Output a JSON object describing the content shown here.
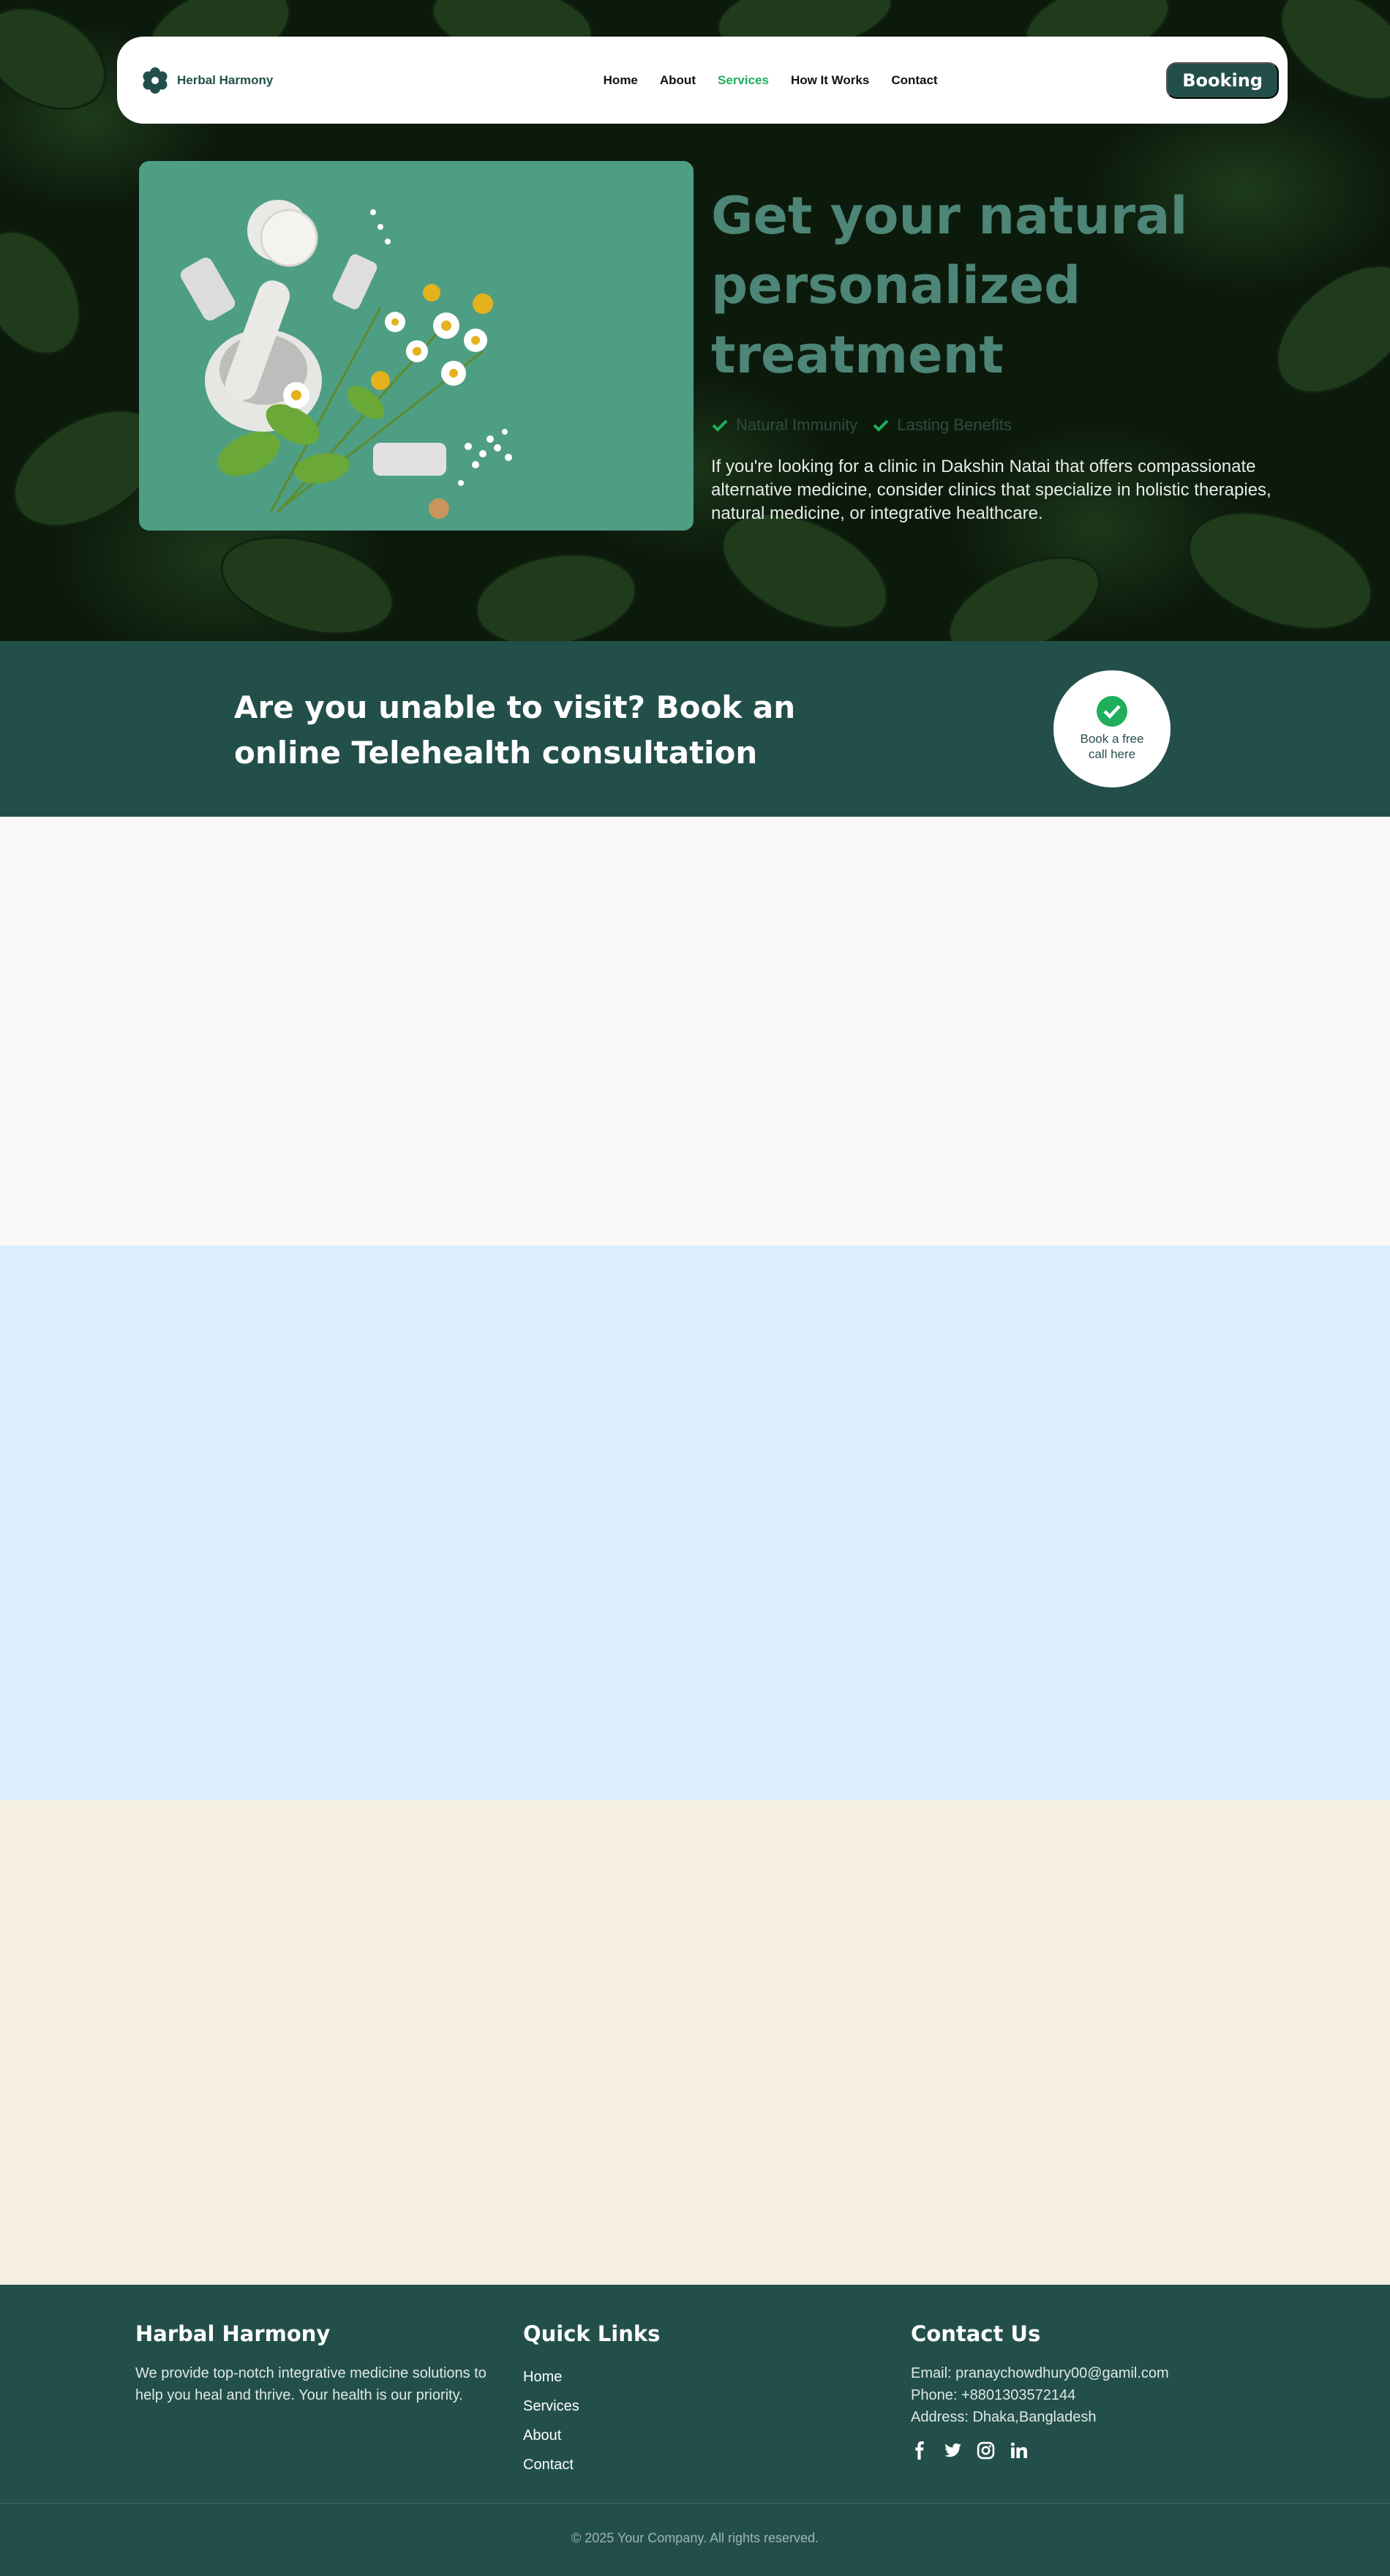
{
  "nav": {
    "brand": "Herbal Harmony",
    "links": [
      "Home",
      "About",
      "Services",
      "How It Works",
      "Contact"
    ],
    "active": "Services",
    "booking": "Booking"
  },
  "hero": {
    "title": "Get your natural personalized treatment",
    "badges": [
      "Natural Immunity",
      "Lasting Benefits"
    ],
    "description": "If you're looking for a clinic in Dakshin Natai that offers compassionate alternative medicine, consider clinics that specialize in holistic therapies, natural medicine, or integrative healthcare."
  },
  "telehealth": {
    "title": "Are you unable to visit? Book an online Telehealth consultation",
    "cta": "Book a free call here"
  },
  "footer": {
    "about": {
      "heading": "Harbal Harmony",
      "text": "We provide top-notch integrative medicine solutions to help you heal and thrive. Your health is our priority."
    },
    "quick_links": {
      "heading": "Quick Links",
      "links": [
        "Home",
        "Services",
        "About",
        "Contact"
      ]
    },
    "contact": {
      "heading": "Contact Us",
      "email": "Email: pranaychowdhury00@gamil.com",
      "phone": "Phone: +8801303572144",
      "address": "Address: Dhaka,Bangladesh",
      "social": [
        "facebook-icon",
        "twitter-icon",
        "instagram-icon",
        "linkedin-icon"
      ]
    },
    "copyright": "© 2025 Your Company. All rights reserved."
  },
  "colors": {
    "primary": "#234f4b",
    "accent": "#1eae5c",
    "hero_title": "#4d8576"
  }
}
